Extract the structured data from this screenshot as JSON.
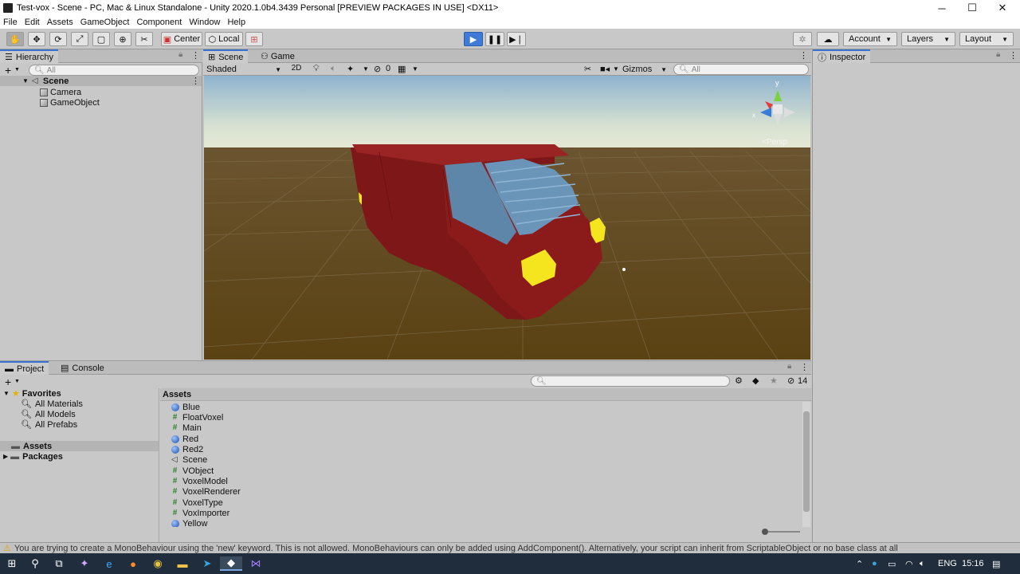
{
  "window": {
    "title": "Test-vox - Scene - PC, Mac & Linux Standalone - Unity 2020.1.0b4.3439 Personal [PREVIEW PACKAGES IN USE] <DX11>",
    "minimize": "─",
    "maximize": "☐",
    "close": "✕"
  },
  "menu": [
    "File",
    "Edit",
    "Assets",
    "GameObject",
    "Component",
    "Window",
    "Help"
  ],
  "toolbar": {
    "pivot_label": "Center",
    "space_label": "Local",
    "account_label": "Account",
    "layers_label": "Layers",
    "layout_label": "Layout"
  },
  "hierarchy": {
    "tab": "Hierarchy",
    "search_placeholder": "All",
    "scene_name": "Scene",
    "items": [
      "Camera",
      "GameObject"
    ]
  },
  "scene": {
    "tab_scene": "Scene",
    "tab_game": "Game",
    "shading_mode": "Shaded",
    "mode_2d": "2D",
    "hidden_count": "0",
    "gizmos_label": "Gizmos",
    "search_placeholder": "All",
    "gizmo_y": "y",
    "gizmo_x": "x",
    "persp_label": "<Persp"
  },
  "inspector": {
    "tab": "Inspector"
  },
  "project": {
    "tab_project": "Project",
    "tab_console": "Console",
    "hidden_count": "14",
    "favorites_label": "Favorites",
    "favorites": [
      "All Materials",
      "All Models",
      "All Prefabs"
    ],
    "tree_assets": "Assets",
    "tree_packages": "Packages",
    "breadcrumb": "Assets",
    "assets": [
      {
        "name": "Blue",
        "kind": "material"
      },
      {
        "name": "FloatVoxel",
        "kind": "script"
      },
      {
        "name": "Main",
        "kind": "script"
      },
      {
        "name": "Red",
        "kind": "material"
      },
      {
        "name": "Red2",
        "kind": "material"
      },
      {
        "name": "Scene",
        "kind": "scene"
      },
      {
        "name": "VObject",
        "kind": "script"
      },
      {
        "name": "VoxelModel",
        "kind": "script"
      },
      {
        "name": "VoxelRenderer",
        "kind": "script"
      },
      {
        "name": "VoxelType",
        "kind": "script"
      },
      {
        "name": "VoxImporter",
        "kind": "script"
      },
      {
        "name": "Yellow",
        "kind": "material"
      }
    ]
  },
  "status": {
    "message": "You are trying to create a MonoBehaviour using the 'new' keyword.  This is not allowed.  MonoBehaviours can only be added using AddComponent(). Alternatively, your script can inherit from ScriptableObject or no base class at all"
  },
  "taskbar": {
    "language": "ENG",
    "time": "15:16"
  },
  "colors": {
    "play_blue": "#3e7ad6",
    "van_red": "#8b1a1a",
    "window_blue": "#5d86a8",
    "headlight_yellow": "#f5e51f",
    "ground_brown": "#5a4213"
  }
}
